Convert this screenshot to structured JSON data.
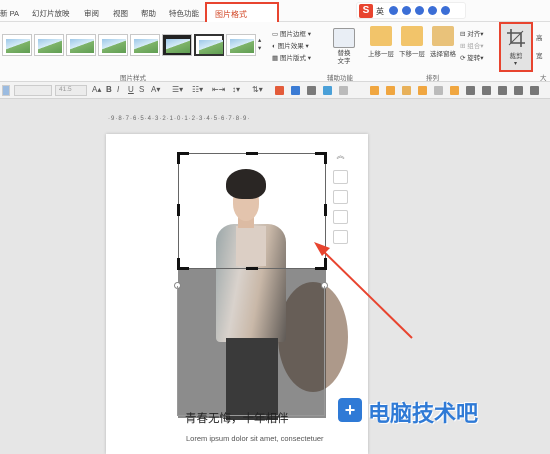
{
  "menubar": {
    "items": [
      "新 PA",
      "幻灯片放映",
      "审阅",
      "视图",
      "帮助",
      "特色功能"
    ],
    "active_tab": "图片格式"
  },
  "sogou": {
    "logo": "S",
    "lang": "英"
  },
  "ribbon": {
    "picture_styles_label": "图片样式",
    "border_label": "图片边框",
    "effects_label": "图片效果",
    "layout_label": "图片版式",
    "alt_text_label": "替换文字",
    "accessibility_label": "辅助功能",
    "bring_forward_label": "上移一层",
    "send_backward_label": "下移一层",
    "selection_pane_label": "选择窗格",
    "align_label": "对齐",
    "group_label": "组合",
    "rotate_label": "旋转",
    "arrange_label": "排列",
    "crop_label": "裁剪",
    "height_label": "高",
    "width_label": "宽",
    "size_label": "大"
  },
  "toolbar2": {
    "font_size": "41.5",
    "bold": "B",
    "italic": "I",
    "underline": "U",
    "shadow": "S"
  },
  "ruler": {
    "text": "·9·8·7·6·5·4·3·2·1·0·1·2·3·4·5·6·7·8·9·"
  },
  "slide": {
    "title": "青春无悔，十年相伴",
    "subtitle": "Lorem ipsum dolor sit amet, consectetuer"
  },
  "watermark": {
    "icon": "+",
    "text": "电脑技术吧"
  },
  "colors": {
    "accent": "#d24726",
    "highlight_box": "#e8442f",
    "watermark": "#2f7ad6"
  }
}
